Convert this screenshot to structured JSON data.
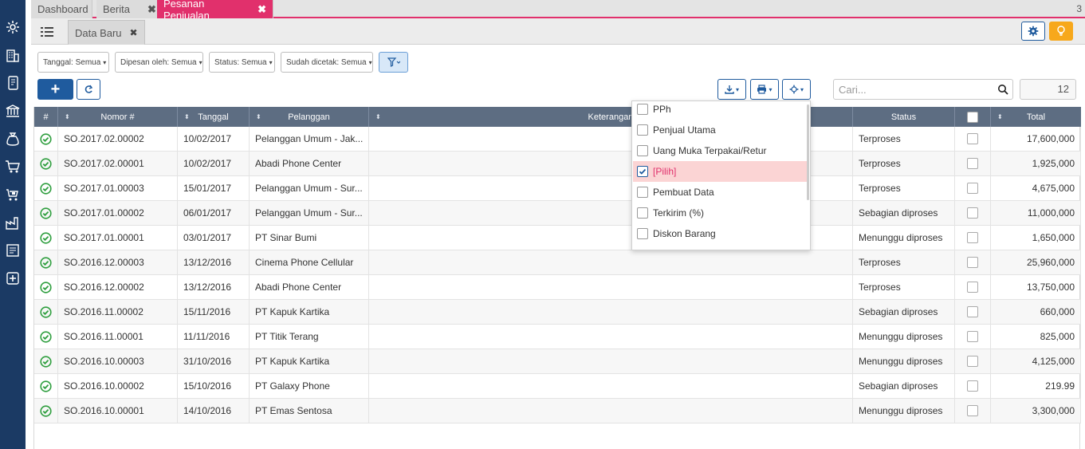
{
  "sidebar": {
    "icons": [
      "gear-icon",
      "building-icon",
      "mobile-icon",
      "bank-icon",
      "moneybag-icon",
      "cart-icon",
      "cart-delivery-icon",
      "factory-icon",
      "report-icon",
      "medical-icon"
    ]
  },
  "tabs": [
    {
      "label": "Dashboard"
    },
    {
      "label": "Berita",
      "close": "✖"
    },
    {
      "label": "Pesanan Penjualan",
      "close": "✖"
    }
  ],
  "tab_count": "3",
  "subtab": {
    "label": "Data Baru",
    "close": "✖"
  },
  "filters": {
    "tanggal": "Tanggal: Semua",
    "dipesan": "Dipesan oleh: Semua",
    "status": "Status: Semua",
    "dicetak": "Sudah dicetak: Semua"
  },
  "search": {
    "placeholder": "Cari...",
    "value": ""
  },
  "record_count": "12",
  "columns": [
    "#",
    "Nomor #",
    "Tanggal",
    "Pelanggan",
    "Keterangan",
    "Status",
    "",
    "Total"
  ],
  "rows": [
    {
      "nomor": "SO.2017.02.00002",
      "tanggal": "10/02/2017",
      "pelanggan": "Pelanggan Umum - Jak...",
      "keterangan": "",
      "status": "Terproses",
      "total": "17,600,000"
    },
    {
      "nomor": "SO.2017.02.00001",
      "tanggal": "10/02/2017",
      "pelanggan": "Abadi Phone Center",
      "keterangan": "",
      "status": "Terproses",
      "total": "1,925,000"
    },
    {
      "nomor": "SO.2017.01.00003",
      "tanggal": "15/01/2017",
      "pelanggan": "Pelanggan Umum - Sur...",
      "keterangan": "",
      "status": "Terproses",
      "total": "4,675,000"
    },
    {
      "nomor": "SO.2017.01.00002",
      "tanggal": "06/01/2017",
      "pelanggan": "Pelanggan Umum - Sur...",
      "keterangan": "",
      "status": "Sebagian diproses",
      "total": "11,000,000"
    },
    {
      "nomor": "SO.2017.01.00001",
      "tanggal": "03/01/2017",
      "pelanggan": "PT Sinar Bumi",
      "keterangan": "",
      "status": "Menunggu diproses",
      "total": "1,650,000"
    },
    {
      "nomor": "SO.2016.12.00003",
      "tanggal": "13/12/2016",
      "pelanggan": "Cinema Phone Cellular",
      "keterangan": "",
      "status": "Terproses",
      "total": "25,960,000"
    },
    {
      "nomor": "SO.2016.12.00002",
      "tanggal": "13/12/2016",
      "pelanggan": "Abadi Phone Center",
      "keterangan": "",
      "status": "Terproses",
      "total": "13,750,000"
    },
    {
      "nomor": "SO.2016.11.00002",
      "tanggal": "15/11/2016",
      "pelanggan": "PT Kapuk Kartika",
      "keterangan": "",
      "status": "Sebagian diproses",
      "total": "660,000"
    },
    {
      "nomor": "SO.2016.11.00001",
      "tanggal": "11/11/2016",
      "pelanggan": "PT Titik Terang",
      "keterangan": "",
      "status": "Menunggu diproses",
      "total": "825,000"
    },
    {
      "nomor": "SO.2016.10.00003",
      "tanggal": "31/10/2016",
      "pelanggan": "PT Kapuk Kartika",
      "keterangan": "",
      "status": "Menunggu diproses",
      "total": "4,125,000"
    },
    {
      "nomor": "SO.2016.10.00002",
      "tanggal": "15/10/2016",
      "pelanggan": "PT Galaxy Phone",
      "keterangan": "",
      "status": "Sebagian diproses",
      "total": "219.99"
    },
    {
      "nomor": "SO.2016.10.00001",
      "tanggal": "14/10/2016",
      "pelanggan": "PT Emas Sentosa",
      "keterangan": "",
      "status": "Menunggu diproses",
      "total": "3,300,000"
    }
  ],
  "column_menu": [
    {
      "label": "PPh",
      "checked": false
    },
    {
      "label": "Penjual Utama",
      "checked": false
    },
    {
      "label": "Uang Muka Terpakai/Retur",
      "checked": false
    },
    {
      "label": "[Pilih]",
      "checked": true
    },
    {
      "label": "Pembuat Data",
      "checked": false
    },
    {
      "label": "Terkirim (%)",
      "checked": false
    },
    {
      "label": "Diskon Barang",
      "checked": false
    }
  ],
  "colors": {
    "accent": "#e1306c",
    "primary": "#1f5b9e",
    "sidebar": "#1b3a64",
    "header": "#5d6d82",
    "status_ok": "#2e9e3e",
    "bulb": "#f7a81b"
  }
}
